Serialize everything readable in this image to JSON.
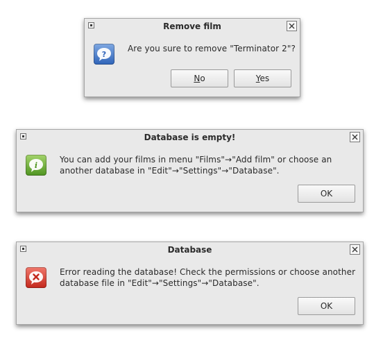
{
  "dialogs": [
    {
      "title": "Remove film",
      "icon": "question-icon",
      "message_lines": [
        "Are you sure to remove \"Terminator 2\"?"
      ],
      "buttons": [
        {
          "mnemonic": "N",
          "rest": "o"
        },
        {
          "mnemonic": "Y",
          "rest": "es"
        }
      ]
    },
    {
      "title": "Database is empty!",
      "icon": "info-icon",
      "message_lines": [
        "You can add your films in menu \"Films\"→\"Add film\" or choose an",
        "another database in \"Edit\"→\"Settings\"→\"Database\"."
      ],
      "buttons": [
        {
          "label": "OK"
        }
      ]
    },
    {
      "title": "Database",
      "icon": "error-icon",
      "message_lines": [
        "Error reading the database! Check the permissions or choose another",
        "database file in \"Edit\"→\"Settings\"→\"Database\"."
      ],
      "buttons": [
        {
          "label": "OK"
        }
      ]
    }
  ],
  "colors": {
    "dialog_bg": "#e9e9e9",
    "question": "#2f64b9",
    "info": "#4f9421",
    "error": "#c3281c"
  }
}
